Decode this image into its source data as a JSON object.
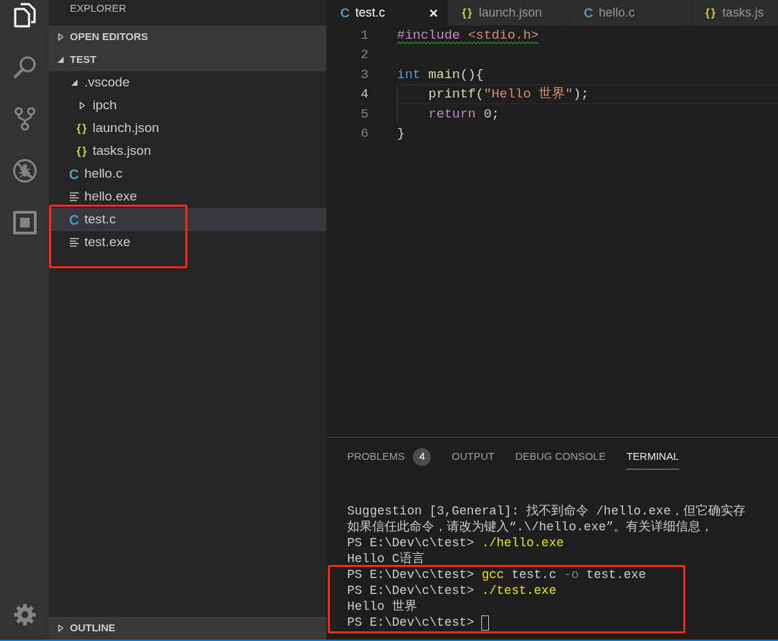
{
  "activity_bar": {
    "items": [
      {
        "kind": "files",
        "selected": true
      },
      {
        "kind": "search",
        "selected": false
      },
      {
        "kind": "source_control",
        "selected": false
      },
      {
        "kind": "debug",
        "selected": false
      },
      {
        "kind": "extensions",
        "selected": false
      }
    ],
    "bottom_items": [
      {
        "kind": "settings",
        "selected": false
      }
    ]
  },
  "sidebar": {
    "title": "EXPLORER",
    "sections": [
      {
        "title": "OPEN EDITORS",
        "expanded": false
      },
      {
        "title": "TEST",
        "expanded": true,
        "items": [
          {
            "name": ".vscode",
            "kind": "folder",
            "expanded": true,
            "selected": false,
            "marked": false,
            "children": [
              {
                "name": "ipch",
                "kind": "folder",
                "expanded": false,
                "selected": false,
                "marked": false
              },
              {
                "name": "launch.json",
                "kind": "json",
                "icon": "{}",
                "selected": false,
                "marked": false
              },
              {
                "name": "tasks.json",
                "kind": "json",
                "icon": "{}",
                "selected": false,
                "marked": false
              }
            ]
          },
          {
            "name": "hello.c",
            "kind": "c",
            "icon": "C",
            "selected": false,
            "marked": false
          },
          {
            "name": "hello.exe",
            "kind": "binary",
            "selected": false,
            "marked": false
          },
          {
            "name": "test.c",
            "kind": "c",
            "icon": "C",
            "selected": true,
            "marked": true
          },
          {
            "name": "test.exe",
            "kind": "binary",
            "selected": false,
            "marked": true
          }
        ]
      }
    ],
    "bottom_sections": [
      {
        "title": "OUTLINE",
        "expanded": false
      }
    ]
  },
  "editor": {
    "tabs": [
      {
        "label": "test.c",
        "kind": "c",
        "icon": "C",
        "selected": true
      },
      {
        "label": "launch.json",
        "kind": "json",
        "icon": "{}",
        "selected": false
      },
      {
        "label": "hello.c",
        "kind": "c",
        "icon": "C",
        "selected": false
      },
      {
        "label": "tasks.js",
        "kind": "json",
        "icon": "{}",
        "selected": false
      }
    ],
    "lines": [
      {
        "number": "1",
        "active": false,
        "warning": true,
        "indented": false,
        "tokens": [
          {
            "text": "#include ",
            "kind": "directive"
          },
          {
            "text": "<stdio.h>",
            "kind": "string"
          }
        ]
      },
      {
        "number": "2",
        "active": false,
        "warning": false,
        "indented": false
      },
      {
        "number": "3",
        "active": false,
        "warning": false,
        "indented": false,
        "tokens": [
          {
            "text": "int ",
            "kind": "type"
          },
          {
            "text": "main",
            "kind": "function"
          },
          {
            "text": "(){",
            "kind": "plain"
          }
        ]
      },
      {
        "number": "4",
        "active": true,
        "warning": false,
        "indented": true,
        "tokens": [
          {
            "text": "printf",
            "kind": "function"
          },
          {
            "text": "(",
            "kind": "plain"
          },
          {
            "text": "\"Hello 世界\"",
            "kind": "string"
          },
          {
            "text": ");",
            "kind": "plain"
          }
        ]
      },
      {
        "number": "5",
        "active": false,
        "warning": false,
        "indented": true,
        "tokens": [
          {
            "text": "return ",
            "kind": "control"
          },
          {
            "text": "0",
            "kind": "number"
          },
          {
            "text": ";",
            "kind": "plain"
          }
        ]
      },
      {
        "number": "6",
        "active": false,
        "warning": false,
        "indented": false,
        "tokens": [
          {
            "text": "}",
            "kind": "plain"
          }
        ]
      }
    ]
  },
  "panel": {
    "tabs": [
      {
        "label": "PROBLEMS",
        "badge": "4",
        "selected": false
      },
      {
        "label": "OUTPUT",
        "selected": false
      },
      {
        "label": "DEBUG CONSOLE",
        "selected": false
      },
      {
        "label": "TERMINAL",
        "selected": true
      }
    ],
    "terminal_lines": [
      {
        "marked": false,
        "cursor": false,
        "segments": [
          {
            "text": "Suggestion [3,General]: 找不到命令 /hello.exe，但它确实存",
            "kind": "plain"
          }
        ]
      },
      {
        "marked": false,
        "cursor": false,
        "segments": [
          {
            "text": "如果信任此命令，请改为键入“.\\/hello.exe”。有关详细信息，",
            "kind": "plain"
          }
        ]
      },
      {
        "marked": false,
        "cursor": false,
        "segments": [
          {
            "text": "PS E:\\Dev\\c\\test> ",
            "kind": "plain"
          },
          {
            "text": "./hello.exe",
            "kind": "command"
          }
        ]
      },
      {
        "marked": false,
        "cursor": false,
        "segments": [
          {
            "text": "Hello C语言",
            "kind": "plain"
          }
        ]
      },
      {
        "marked": true,
        "cursor": false,
        "segments": [
          {
            "text": "PS E:\\Dev\\c\\test> ",
            "kind": "plain"
          },
          {
            "text": "gcc",
            "kind": "command"
          },
          {
            "text": " test.c ",
            "kind": "plain"
          },
          {
            "text": "-o",
            "kind": "option"
          },
          {
            "text": " test.exe",
            "kind": "plain"
          }
        ]
      },
      {
        "marked": true,
        "cursor": false,
        "segments": [
          {
            "text": "PS E:\\Dev\\c\\test> ",
            "kind": "plain"
          },
          {
            "text": "./test.exe",
            "kind": "command"
          }
        ]
      },
      {
        "marked": true,
        "cursor": false,
        "segments": [
          {
            "text": "Hello 世界",
            "kind": "plain"
          }
        ]
      },
      {
        "marked": true,
        "cursor": true,
        "segments": [
          {
            "text": "PS E:\\Dev\\c\\test> ",
            "kind": "plain"
          }
        ]
      }
    ]
  }
}
